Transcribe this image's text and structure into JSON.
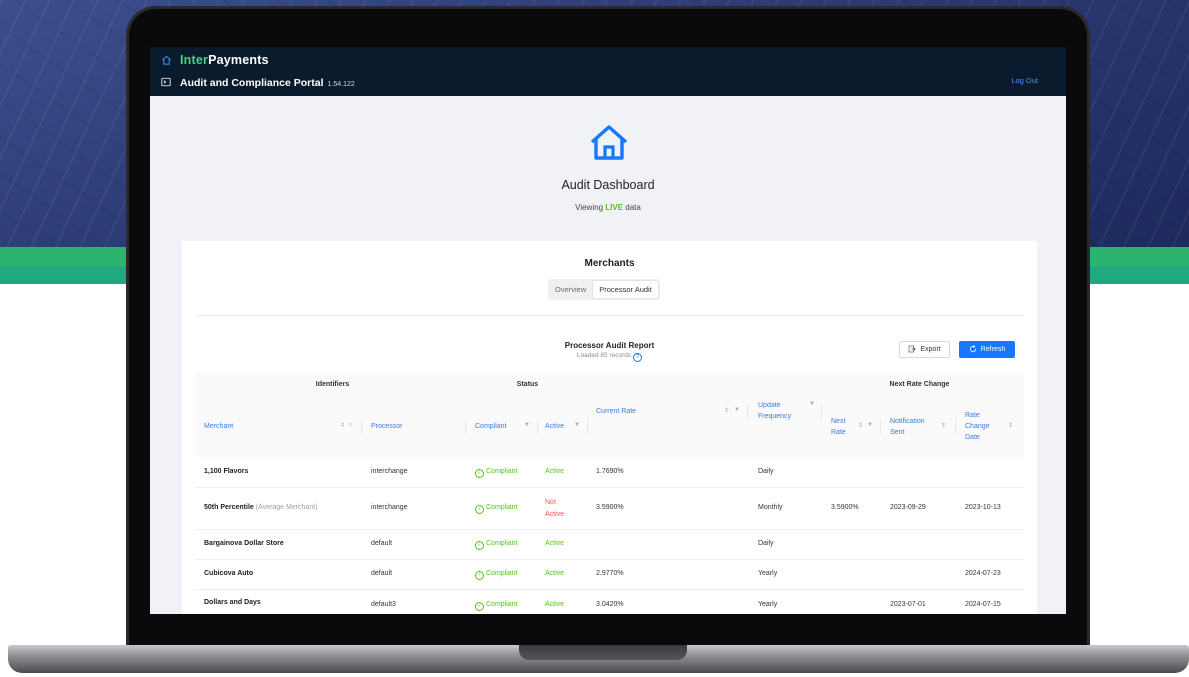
{
  "app": {
    "brand_part1": "Inter",
    "brand_part2": "Payments",
    "portal_title": "Audit and Compliance Portal",
    "version": "1.54.122",
    "logout": "Log Out"
  },
  "dashboard": {
    "title": "Audit Dashboard",
    "sub_prefix": "Viewing",
    "sub_live": "LIVE",
    "sub_suffix": "data"
  },
  "merchants": {
    "title": "Merchants",
    "tabs": [
      {
        "label": "Overview",
        "active": false
      },
      {
        "label": "Processor Audit",
        "active": true
      }
    ]
  },
  "report": {
    "title": "Processor Audit Report",
    "subtitle": "Loaded 85 records",
    "export_label": "Export",
    "refresh_label": "Refresh"
  },
  "table": {
    "groups": {
      "identifiers": "Identifiers",
      "status": "Status",
      "next_rate_change": "Next Rate Change"
    },
    "columns": {
      "merchant": "Merchant",
      "processor": "Processor",
      "compliant": "Compliant",
      "active": "Active",
      "current_rate": "Current Rate",
      "update_frequency_1": "Update",
      "update_frequency_2": "Frequency",
      "next_rate_1": "Next",
      "next_rate_2": "Rate",
      "notification_sent_1": "Notification",
      "notification_sent_2": "Sent",
      "rate_change_date_1": "Rate",
      "rate_change_date_2": "Change",
      "rate_change_date_3": "Date"
    },
    "rows": [
      {
        "merchant": "1,100 Flavors",
        "merchant_note": "",
        "processor": "interchange",
        "compliant": "Compliant",
        "active_1": "Active",
        "active_2": "",
        "active_state": "active",
        "current_rate": "1.7690%",
        "update_frequency": "Daily",
        "next_rate": "",
        "notification_sent": "",
        "rate_change_date": ""
      },
      {
        "merchant": "50th Percentile",
        "merchant_note": "(Average Merchant)",
        "processor": "interchange",
        "compliant": "Compliant",
        "active_1": "Not",
        "active_2": "Active",
        "active_state": "inactive",
        "current_rate": "3.5900%",
        "update_frequency": "Monthly",
        "next_rate": "3.5900%",
        "notification_sent": "2023-09-29",
        "rate_change_date": "2023-10-13"
      },
      {
        "merchant": "Bargainova Dollar Store",
        "merchant_note": "",
        "processor": "default",
        "compliant": "Compliant",
        "active_1": "Active",
        "active_2": "",
        "active_state": "active",
        "current_rate": "",
        "update_frequency": "Daily",
        "next_rate": "",
        "notification_sent": "",
        "rate_change_date": ""
      },
      {
        "merchant": "Cubicova Auto",
        "merchant_note": "",
        "processor": "default",
        "compliant": "Compliant",
        "active_1": "Active",
        "active_2": "",
        "active_state": "active",
        "current_rate": "2.9770%",
        "update_frequency": "Yearly",
        "next_rate": "",
        "notification_sent": "",
        "rate_change_date": "2024-07-23"
      },
      {
        "merchant": "Dollars and Days",
        "merchant_note": "",
        "processor": "default3",
        "compliant": "Compliant",
        "active_1": "Active",
        "active_2": "",
        "active_state": "active",
        "current_rate": "3.0420%",
        "update_frequency": "Yearly",
        "next_rate": "",
        "notification_sent": "2023-07-01",
        "rate_change_date": "2024-07-15"
      }
    ]
  },
  "colors": {
    "app_bar": "#0b1b2e",
    "brand_accent": "#3dd68c",
    "primary": "#1677ff",
    "success": "#52c41a",
    "danger": "#ff4d4f"
  },
  "icons": {
    "home": "home-icon",
    "terminal": "terminal-icon",
    "dashboard": "house-icon",
    "export": "export-icon",
    "refresh": "refresh-icon",
    "info": "info-icon",
    "sort": "sort-icon",
    "filter": "filter-icon",
    "search": "search-icon",
    "check": "check-circle-icon"
  }
}
